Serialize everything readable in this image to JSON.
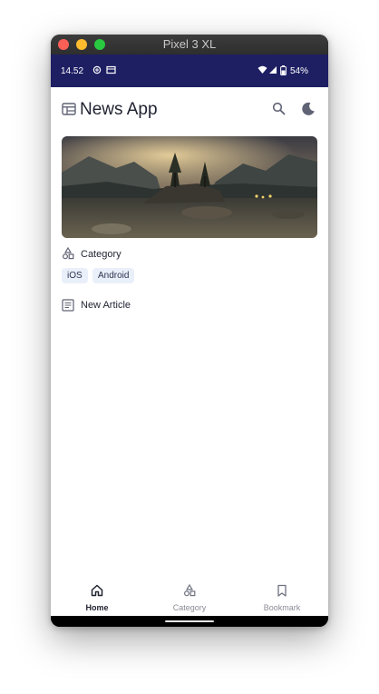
{
  "window": {
    "title": "Pixel 3 XL"
  },
  "status_bar": {
    "time": "14.52",
    "battery": "54%"
  },
  "app_bar": {
    "title": "News App"
  },
  "category_section": {
    "label": "Category",
    "chips": [
      "iOS",
      "Android"
    ]
  },
  "article_section": {
    "label": "New Article"
  },
  "bottom_nav": {
    "items": [
      {
        "label": "Home",
        "icon": "home-icon",
        "active": true
      },
      {
        "label": "Category",
        "icon": "category-icon",
        "active": false
      },
      {
        "label": "Bookmark",
        "icon": "bookmark-icon",
        "active": false
      }
    ]
  },
  "colors": {
    "status_bar": "#1e1f63",
    "icon_gray": "#5f6374",
    "chip_bg": "#eaf0fa"
  }
}
